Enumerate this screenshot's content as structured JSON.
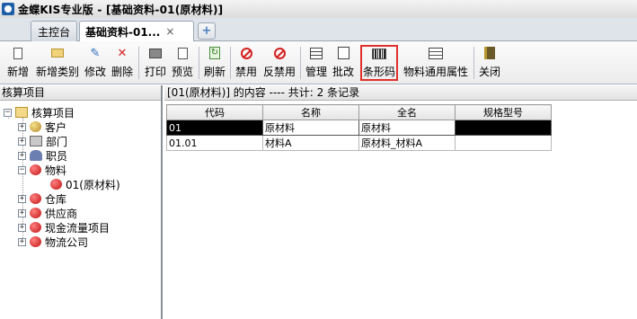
{
  "window": {
    "title": "金蝶KIS专业版 - [基础资料-01(原材料)]"
  },
  "tabs": [
    {
      "label": "主控台"
    },
    {
      "label": "基础资料-01...",
      "close": "×"
    }
  ],
  "toolbar": {
    "new": "新增",
    "new_category": "新增类别",
    "modify": "修改",
    "delete": "删除",
    "print": "打印",
    "preview": "预览",
    "refresh": "刷新",
    "disable": "禁用",
    "enable": "反禁用",
    "manage": "管理",
    "batch_edit": "批改",
    "barcode": "条形码",
    "material_props": "物料通用属性",
    "close": "关闭"
  },
  "left_panel": {
    "header": "核算项目",
    "tree": [
      {
        "label": "核算项目",
        "expander": "−"
      },
      {
        "label": "客户",
        "expander": "+"
      },
      {
        "label": "部门",
        "expander": "+"
      },
      {
        "label": "职员",
        "expander": "+"
      },
      {
        "label": "物料",
        "expander": "−"
      },
      {
        "label": "01(原材料)"
      },
      {
        "label": "仓库",
        "expander": "+"
      },
      {
        "label": "供应商",
        "expander": "+"
      },
      {
        "label": "现金流量项目",
        "expander": "+"
      },
      {
        "label": "物流公司",
        "expander": "+"
      }
    ]
  },
  "right_panel": {
    "summary": "[01(原材料)] 的内容 ---- 共计: 2 条记录",
    "columns": [
      "代码",
      "名称",
      "全名",
      "规格型号"
    ],
    "rows": [
      [
        "01",
        "原材料",
        "原材料",
        ""
      ],
      [
        "01.01",
        "材料A",
        "原材料_材料A",
        ""
      ]
    ]
  },
  "colors": {
    "highlight_border": "#e0302a",
    "selected_row": "#000000"
  }
}
